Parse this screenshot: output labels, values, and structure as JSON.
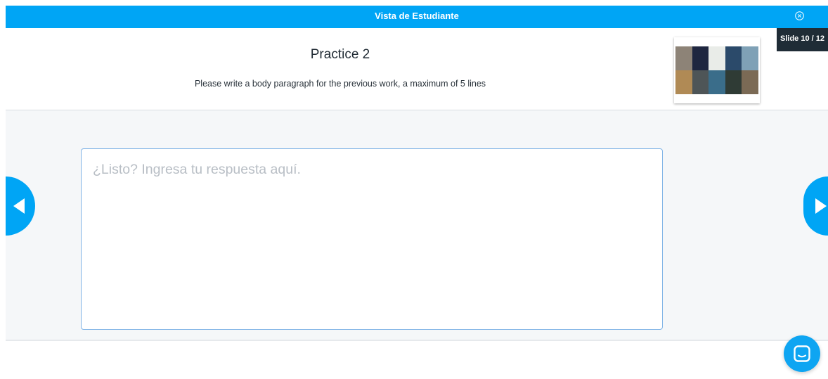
{
  "topbar": {
    "title": "Vista de Estudiante",
    "close_icon": "close-circle-icon"
  },
  "slide_counter": "Slide 10 / 12",
  "slide": {
    "title": "Practice 2",
    "subtitle": "Please write a body paragraph for the previous work, a maximum of 5 lines",
    "thumbnail": "animal-collage-image"
  },
  "answer": {
    "value": "",
    "placeholder": "¿Listo? Ingresa tu respuesta aquí."
  },
  "navigation": {
    "prev_icon": "triangle-left-icon",
    "next_icon": "triangle-right-icon"
  },
  "chat": {
    "icon": "chat-bubble-icon"
  },
  "colors": {
    "accent": "#00a5f5",
    "badge": "#1f2c36",
    "body_bg": "#f5f7f9",
    "input_border": "#7fb3e6"
  }
}
